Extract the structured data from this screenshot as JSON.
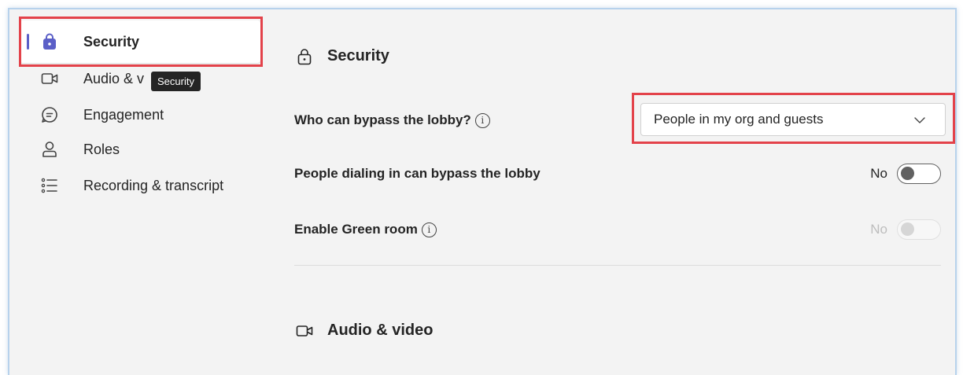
{
  "sidebar": {
    "items": [
      {
        "label": "Security",
        "icon": "lock-bag-icon",
        "active": true
      },
      {
        "label": "Audio & v",
        "icon": "video-camera-icon"
      },
      {
        "label": "Engagement",
        "icon": "chat-bubble-icon"
      },
      {
        "label": "Roles",
        "icon": "person-icon"
      },
      {
        "label": "Recording & transcript",
        "icon": "list-icon"
      }
    ],
    "tooltip": "Security"
  },
  "main": {
    "security": {
      "title": "Security",
      "lobby_label": "Who can bypass the lobby?",
      "lobby_value": "People in my org and guests",
      "dialin_label": "People dialing in can bypass the lobby",
      "dialin_value": "No",
      "greenroom_label": "Enable Green room",
      "greenroom_value": "No"
    },
    "audio_video": {
      "title": "Audio & video"
    }
  },
  "colors": {
    "accent": "#5b5fc7",
    "highlight": "#e3424a",
    "background": "#f3f3f3"
  }
}
